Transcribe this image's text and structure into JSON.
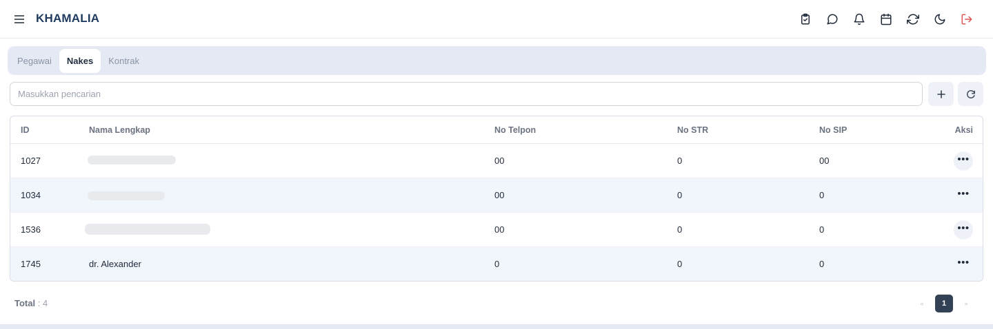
{
  "app": {
    "brand": "KHAMALIA"
  },
  "header": {
    "icons": [
      "clipboard-check-icon",
      "chat-icon",
      "bell-icon",
      "calendar-icon",
      "refresh-icon",
      "moon-icon",
      "logout-icon"
    ],
    "logout_color": "#e25555"
  },
  "tabs": [
    {
      "label": "Pegawai",
      "active": false
    },
    {
      "label": "Nakes",
      "active": true
    },
    {
      "label": "Kontrak",
      "active": false
    }
  ],
  "search": {
    "placeholder": "Masukkan pencarian",
    "value": ""
  },
  "table": {
    "columns": [
      "ID",
      "Nama Lengkap",
      "No Telpon",
      "No STR",
      "No SIP",
      "Aksi"
    ],
    "rows": [
      {
        "id": "1027",
        "name": "",
        "phone": "00",
        "str": "0",
        "sip": "00"
      },
      {
        "id": "1034",
        "name": "",
        "phone": "00",
        "str": "0",
        "sip": "0"
      },
      {
        "id": "1536",
        "name": "",
        "phone": "00",
        "str": "0",
        "sip": "0"
      },
      {
        "id": "1745",
        "name": "dr. Alexander",
        "phone": "0",
        "str": "0",
        "sip": "0"
      }
    ],
    "row_action_icon": "more-horizontal-icon"
  },
  "footer": {
    "total_label": "Total",
    "total_value": ": 4"
  },
  "pagination": {
    "prev": "«",
    "current": "1",
    "next": "»"
  },
  "colors": {
    "accent": "#334155",
    "tab_bg": "#e4e9f3",
    "row_alt": "#f1f5fc"
  }
}
